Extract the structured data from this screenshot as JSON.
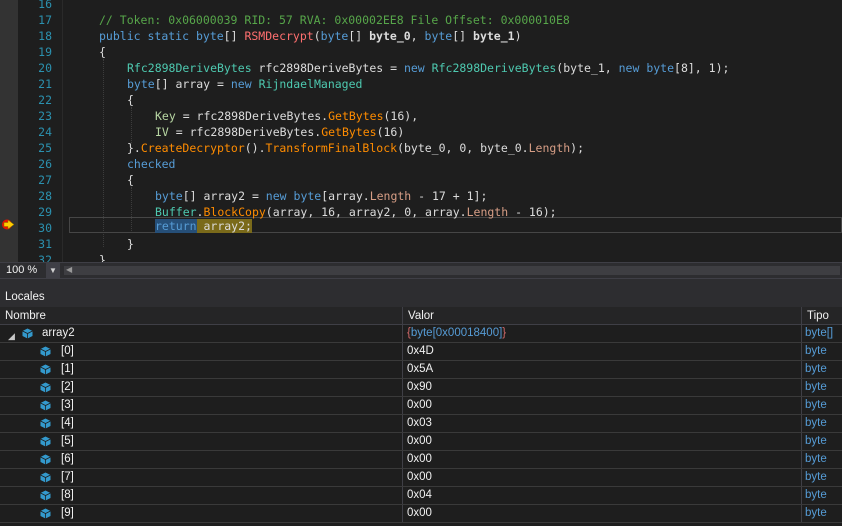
{
  "editor": {
    "line_numbers": [
      "16",
      "17",
      "18",
      "19",
      "20",
      "21",
      "22",
      "23",
      "24",
      "25",
      "26",
      "27",
      "28",
      "29",
      "30",
      "31",
      "32"
    ],
    "current_line": "30",
    "code": {
      "l17_comment": "// Token: 0x06000039 RID: 57 RVA: 0x00002EE8 File Offset: 0x000010E8",
      "l18_public": "public",
      "l18_static": "static",
      "l18_byte": "byte",
      "l18_brackets": "[] ",
      "l18_method": "RSMDecrypt",
      "l18_open": "(",
      "l18_byte2": "byte",
      "l18_p0type": "[] ",
      "l18_p0": "byte_0",
      "l18_comma": ", ",
      "l18_byte3": "byte",
      "l18_p1type": "[] ",
      "l18_p1": "byte_1",
      "l18_close": ")",
      "l19": "{",
      "l20_type": "Rfc2898DeriveBytes",
      "l20_var": " rfc2898DeriveBytes = ",
      "l20_new": "new",
      "l20_type2": "Rfc2898DeriveBytes",
      "l20_args1": "(byte_1, ",
      "l20_new2": "new",
      "l20_byte": "byte",
      "l20_args2": "[8], 1);",
      "l21_byte": "byte",
      "l21_var": "[] array = ",
      "l21_new": "new",
      "l21_type": "RijndaelManaged",
      "l22": "{",
      "l23_key": "Key",
      "l23_mid": " = rfc2898DeriveBytes.",
      "l23_method": "GetBytes",
      "l23_end": "(16),",
      "l24_iv": "IV",
      "l24_mid": " = rfc2898DeriveBytes.",
      "l24_method": "GetBytes",
      "l24_end": "(16)",
      "l25_start": "}.",
      "l25_method1": "CreateDecryptor",
      "l25_mid": "().",
      "l25_method2": "TransformFinalBlock",
      "l25_args": "(byte_0, 0, byte_0.",
      "l25_prop": "Length",
      "l25_end": ");",
      "l26": "checked",
      "l27": "{",
      "l28_byte": "byte",
      "l28_mid": "[] array2 = ",
      "l28_new": "new",
      "l28_byte2": "byte",
      "l28_args": "[array.",
      "l28_prop": "Length",
      "l28_end": " - 17 + 1];",
      "l29_type": "Buffer",
      "l29_dot": ".",
      "l29_method": "BlockCopy",
      "l29_args": "(array, 16, array2, 0, array.",
      "l29_prop": "Length",
      "l29_end": " - 16);",
      "l30_return": "return",
      "l30_rest": " array2;",
      "l31": "}",
      "l32": "}"
    }
  },
  "zoom": {
    "value": "100 %",
    "dropdown_icon": "chevron-down-icon"
  },
  "locals": {
    "title": "Locales",
    "columns": {
      "name": "Nombre",
      "value": "Valor",
      "type": "Tipo"
    },
    "parent": {
      "name": "array2",
      "value_open": "{",
      "value_type": "byte",
      "value_size": "[0x00018400]",
      "value_close": "}",
      "type": "byte[]"
    },
    "items": [
      {
        "name": "[0]",
        "value": "0x4D",
        "type": "byte"
      },
      {
        "name": "[1]",
        "value": "0x5A",
        "type": "byte"
      },
      {
        "name": "[2]",
        "value": "0x90",
        "type": "byte"
      },
      {
        "name": "[3]",
        "value": "0x00",
        "type": "byte"
      },
      {
        "name": "[4]",
        "value": "0x03",
        "type": "byte"
      },
      {
        "name": "[5]",
        "value": "0x00",
        "type": "byte"
      },
      {
        "name": "[6]",
        "value": "0x00",
        "type": "byte"
      },
      {
        "name": "[7]",
        "value": "0x00",
        "type": "byte"
      },
      {
        "name": "[8]",
        "value": "0x04",
        "type": "byte"
      },
      {
        "name": "[9]",
        "value": "0x00",
        "type": "byte"
      }
    ]
  },
  "colors": {
    "keyword": "#569cd6",
    "type": "#4ec9b0",
    "comment": "#57a64a",
    "method": "#ff8c00",
    "line_number": "#2b91af"
  }
}
